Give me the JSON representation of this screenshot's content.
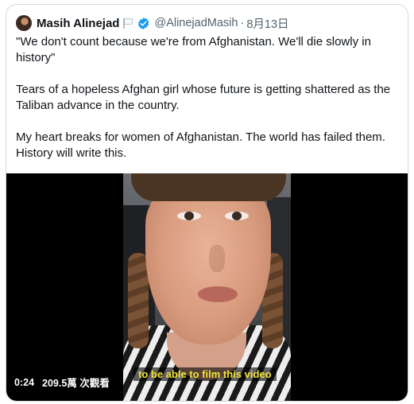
{
  "tweet": {
    "display_name": "Masih Alinejad",
    "handle": "@AlinejadMasih",
    "separator": "·",
    "date": "8月13日",
    "paragraphs": [
      "\"We don't count because we're from Afghanistan. We'll die slowly in history\"",
      "Tears of a hopeless Afghan girl whose future is getting shattered as the Taliban advance in the country.",
      "My heart breaks for women of Afghanistan. The world has failed them. History will write this."
    ],
    "icons": {
      "avatar": "avatar",
      "flag": "white-flag-icon",
      "verified": "verified-badge-icon"
    },
    "colors": {
      "verified": "#1d9bf0",
      "subtitle": "#f2e33a",
      "secondary_text": "#536471"
    }
  },
  "video": {
    "subtitle": "to be able to film this video",
    "time": "0:24",
    "views": "209.5萬 次觀看"
  }
}
